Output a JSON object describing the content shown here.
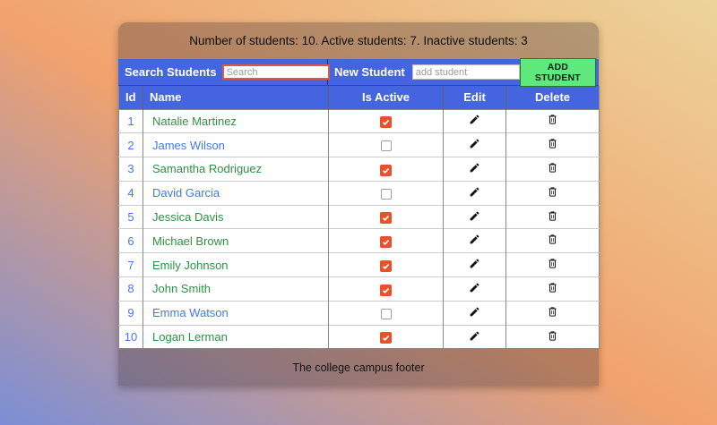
{
  "header": {
    "summary": "Number of students: 10. Active students: 7. Inactive students: 3"
  },
  "toolbar": {
    "search_label": "Search Students",
    "search_placeholder": "Search",
    "new_student_label": "New Student",
    "new_student_placeholder": "add student",
    "add_button_label": "ADD STUDENT"
  },
  "table": {
    "columns": [
      "Id",
      "Name",
      "Is Active",
      "Edit",
      "Delete"
    ],
    "rows": [
      {
        "id": "1",
        "name": "Natalie Martinez",
        "active": true
      },
      {
        "id": "2",
        "name": "James Wilson",
        "active": false
      },
      {
        "id": "3",
        "name": "Samantha Rodriguez",
        "active": true
      },
      {
        "id": "4",
        "name": "David Garcia",
        "active": false
      },
      {
        "id": "5",
        "name": "Jessica Davis",
        "active": true
      },
      {
        "id": "6",
        "name": "Michael Brown",
        "active": true
      },
      {
        "id": "7",
        "name": "Emily Johnson",
        "active": true
      },
      {
        "id": "8",
        "name": "John Smith",
        "active": true
      },
      {
        "id": "9",
        "name": "Emma Watson",
        "active": false
      },
      {
        "id": "10",
        "name": "Logan Lerman",
        "active": true
      }
    ]
  },
  "footer": {
    "text": "The college campus footer"
  },
  "icons": {
    "edit": "pencil-icon",
    "delete": "trash-icon",
    "checked": "checkmark-icon"
  },
  "colors": {
    "accent_blue": "#4565e0",
    "active_name_green": "#2d9144",
    "inactive_name_blue": "#4577e8",
    "checkbox_checked": "#e8512a",
    "add_button_green": "#5fe87b",
    "search_border_red": "#e05745"
  }
}
